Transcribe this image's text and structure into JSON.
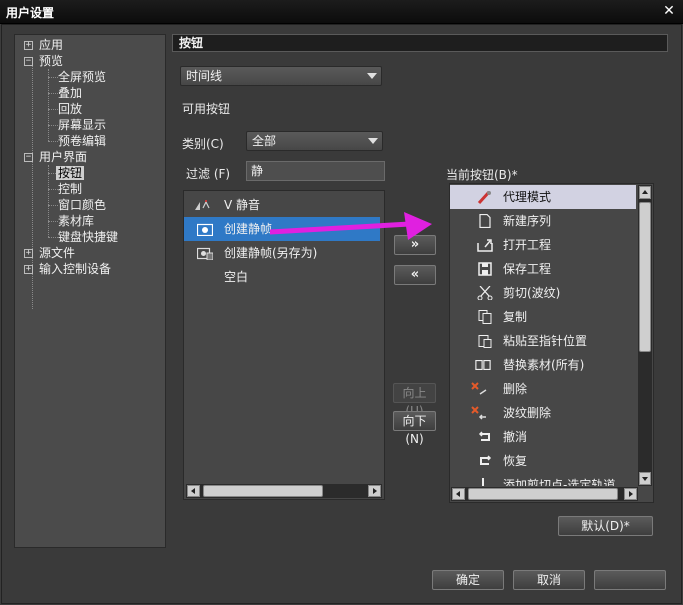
{
  "window": {
    "title": "用户设置",
    "close_glyph": "✕"
  },
  "tree": {
    "items": [
      {
        "label": "应用",
        "expander": "+"
      },
      {
        "label": "预览",
        "expander": "−"
      },
      {
        "label": "全屏预览"
      },
      {
        "label": "叠加"
      },
      {
        "label": "回放"
      },
      {
        "label": "屏幕显示"
      },
      {
        "label": "预卷编辑"
      },
      {
        "label": "用户界面",
        "expander": "−"
      },
      {
        "label": "按钮",
        "selected": true
      },
      {
        "label": "控制"
      },
      {
        "label": "窗口颜色"
      },
      {
        "label": "素材库"
      },
      {
        "label": "键盘快捷键"
      },
      {
        "label": "源文件",
        "expander": "+"
      },
      {
        "label": "输入控制设备",
        "expander": "+"
      }
    ]
  },
  "panel": {
    "header": "按钮",
    "target_select": "时间线",
    "available_label": "可用按钮",
    "category_label": "类别(C)",
    "category_value": "全部",
    "filter_label": "过滤 (F)",
    "filter_value": "静",
    "current_label": "当前按钮(B)*"
  },
  "available_buttons": [
    {
      "label": "V 静音",
      "icon": "mute-icon"
    },
    {
      "label": "创建静帧",
      "icon": "camera-icon",
      "selected": true
    },
    {
      "label": "创建静帧(另存为)",
      "icon": "camera-save-icon"
    },
    {
      "label": "空白",
      "icon": ""
    }
  ],
  "current_buttons": [
    {
      "label": "代理模式",
      "icon": "proxy-icon",
      "selected": true
    },
    {
      "label": "新建序列",
      "icon": "new-document-icon"
    },
    {
      "label": "打开工程",
      "icon": "open-project-icon"
    },
    {
      "label": "保存工程",
      "icon": "save-icon"
    },
    {
      "label": "剪切(波纹)",
      "icon": "scissors-icon"
    },
    {
      "label": "复制",
      "icon": "copy-icon"
    },
    {
      "label": "粘贴至指针位置",
      "icon": "paste-icon"
    },
    {
      "label": "替换素材(所有)",
      "icon": "replace-icon"
    },
    {
      "label": "删除",
      "icon": "delete-icon"
    },
    {
      "label": "波纹删除",
      "icon": "ripple-delete-icon"
    },
    {
      "label": "撤消",
      "icon": "undo-icon"
    },
    {
      "label": "恢复",
      "icon": "redo-icon"
    },
    {
      "label": "添加剪切点-选定轨道",
      "icon": "add-cut-icon"
    }
  ],
  "buttons": {
    "add": "»",
    "remove": "«",
    "up": "向上(U)",
    "down": "向下(N)",
    "default": "默认(D)*",
    "ok": "确定",
    "cancel": "取消",
    "apply": ""
  },
  "colors": {
    "selection_blue": "#2f79c6",
    "annotation_arrow": "#e020e0"
  }
}
